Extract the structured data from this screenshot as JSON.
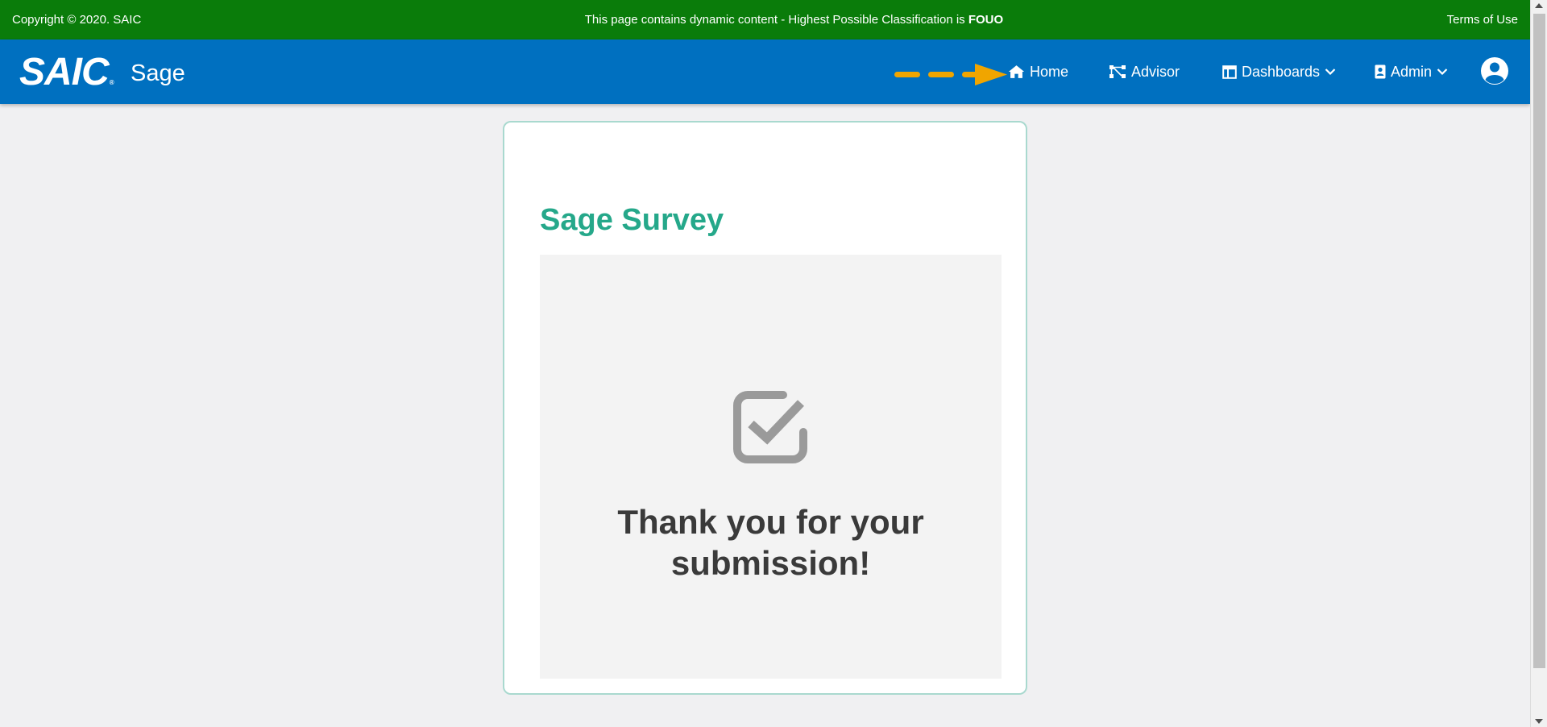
{
  "classification_bar": {
    "copyright": "Copyright © 2020. SAIC",
    "notice_prefix": "This page contains dynamic content - Highest Possible Classification is ",
    "classification": "FOUO",
    "terms_link": "Terms of Use",
    "background": "#0a7c0a"
  },
  "navbar": {
    "logo_text": "SAIC",
    "logo_mark": "®",
    "app_name": "Sage",
    "background": "#0070c0",
    "items": [
      {
        "label": "Home",
        "icon": "home-icon"
      },
      {
        "label": "Advisor",
        "icon": "network-icon"
      },
      {
        "label": "Dashboards",
        "icon": "dashboard-icon",
        "dropdown": true
      },
      {
        "label": "Admin",
        "icon": "badge-icon",
        "dropdown": true
      }
    ],
    "profile_icon": "user-circle-icon",
    "annotation_arrow_color": "#f0a500"
  },
  "survey": {
    "title": "Sage Survey",
    "title_color": "#25a88a",
    "status_icon": "checkbox-checked-icon",
    "message": "Thank you for your submission!"
  }
}
